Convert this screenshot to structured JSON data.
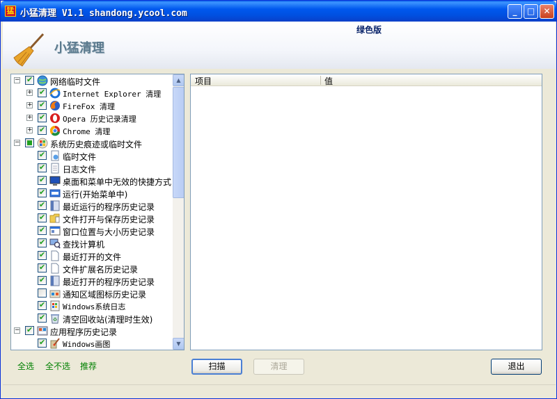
{
  "window": {
    "title": "小猛清理 V1.1 shandong.ycool.com",
    "icon_glyph": "猛",
    "controls": {
      "minimize": "_",
      "maximize": "□",
      "close": "✕"
    }
  },
  "header": {
    "app_name": "小猛清理",
    "edition": "绿色版",
    "logo_icon": "broom-icon"
  },
  "tree": {
    "nodes": [
      {
        "label": "网络临时文件",
        "expander": "−",
        "checked": "on",
        "icon": "globe-icon",
        "mono": false
      },
      {
        "label": "Internet Explorer 清理",
        "expander": "+",
        "checked": "on",
        "icon": "ie-icon",
        "mono": true
      },
      {
        "label": "FireFox 清理",
        "expander": "+",
        "checked": "on",
        "icon": "firefox-icon",
        "mono": true
      },
      {
        "label": "Opera 历史记录清理",
        "expander": "+",
        "checked": "on",
        "icon": "opera-icon",
        "mono": true
      },
      {
        "label": "Chrome 清理",
        "expander": "+",
        "checked": "on",
        "icon": "chrome-icon",
        "mono": true
      },
      {
        "label": "系统历史痕迹或临时文件",
        "expander": "−",
        "checked": "mixed",
        "icon": "windows-icon",
        "mono": false
      },
      {
        "label": "临时文件",
        "checked": "on",
        "icon": "temp-file-icon",
        "mono": false
      },
      {
        "label": "日志文件",
        "checked": "on",
        "icon": "log-file-icon",
        "mono": false
      },
      {
        "label": "桌面和菜单中无效的快捷方式",
        "checked": "on",
        "icon": "desktop-icon",
        "mono": false
      },
      {
        "label": "运行(开始菜单中)",
        "checked": "on",
        "icon": "run-icon",
        "mono": false
      },
      {
        "label": "最近运行的程序历史记录",
        "checked": "on",
        "icon": "program-icon",
        "mono": false
      },
      {
        "label": "文件打开与保存历史记录",
        "checked": "on",
        "icon": "folder-icon",
        "mono": false
      },
      {
        "label": "窗口位置与大小历史记录",
        "checked": "on",
        "icon": "window-icon",
        "mono": false
      },
      {
        "label": "查找计算机",
        "checked": "on",
        "icon": "search-computer-icon",
        "mono": false
      },
      {
        "label": "最近打开的文件",
        "checked": "on",
        "icon": "document-icon",
        "mono": false
      },
      {
        "label": "文件扩展名历史记录",
        "checked": "on",
        "icon": "document-icon",
        "mono": false
      },
      {
        "label": "最近打开的程序历史记录",
        "checked": "on",
        "icon": "program-icon",
        "mono": false
      },
      {
        "label": "通知区域图标历史记录",
        "checked": "off",
        "icon": "tray-icon",
        "mono": false
      },
      {
        "label": "Windows系统日志",
        "checked": "on",
        "icon": "event-log-icon",
        "mono": true
      },
      {
        "label": "清空回收站(清理时生效)",
        "checked": "on",
        "icon": "recycle-bin-icon",
        "mono": false
      },
      {
        "label": "应用程序历史记录",
        "expander": "−",
        "checked": "on",
        "icon": "applications-icon",
        "mono": false
      },
      {
        "label": "Windows画图",
        "checked": "on",
        "icon": "paint-icon",
        "mono": true
      }
    ]
  },
  "list": {
    "columns": [
      "项目",
      "值"
    ]
  },
  "footer": {
    "select_all": "全选",
    "select_none": "全不选",
    "recommend": "推荐",
    "scan": "扫描",
    "clean": "清理",
    "exit": "退出"
  }
}
